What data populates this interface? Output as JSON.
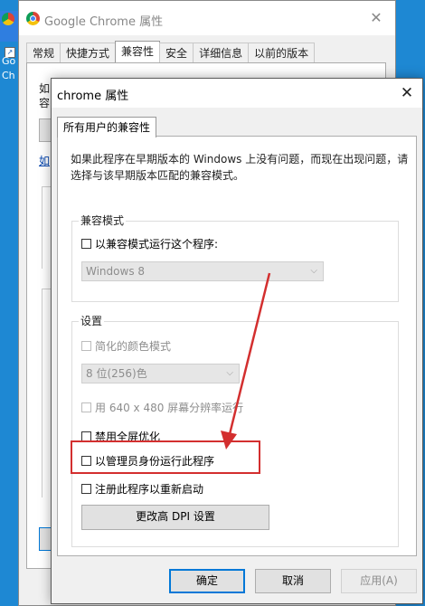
{
  "desktop": {
    "icon_label_line1": "Go",
    "icon_label_line2": "Ch"
  },
  "back_window": {
    "title": "Google Chrome 属性",
    "tabs": [
      "常规",
      "快捷方式",
      "兼容性",
      "安全",
      "详细信息",
      "以前的版本"
    ],
    "active_tab_index": 2,
    "snippet_1": "如",
    "snippet_2": "容",
    "link_snippet": "如"
  },
  "front_window": {
    "title": "chrome 属性",
    "tab_label": "所有用户的兼容性",
    "description": "如果此程序在早期版本的 Windows 上没有问题，而现在出现问题，请选择与该早期版本匹配的兼容模式。",
    "compat_group": {
      "title": "兼容模式",
      "checkbox_label": "以兼容模式运行这个程序:",
      "checked": false,
      "os_select_value": "Windows 8"
    },
    "settings_group": {
      "title": "设置",
      "reduced_color_label": "简化的颜色模式",
      "color_select_value": "8 位(256)色",
      "resolution_label": "用 640 x 480 屏幕分辨率运行",
      "disable_fullscreen_label": "禁用全屏优化",
      "run_as_admin_label": "以管理员身份运行此程序",
      "register_restart_label": "注册此程序以重新启动",
      "dpi_button_label": "更改高 DPI 设置"
    },
    "footer": {
      "ok_label": "确定",
      "cancel_label": "取消",
      "apply_label": "应用(A)"
    }
  },
  "annotation": {
    "highlight_color": "#d32f2f"
  }
}
